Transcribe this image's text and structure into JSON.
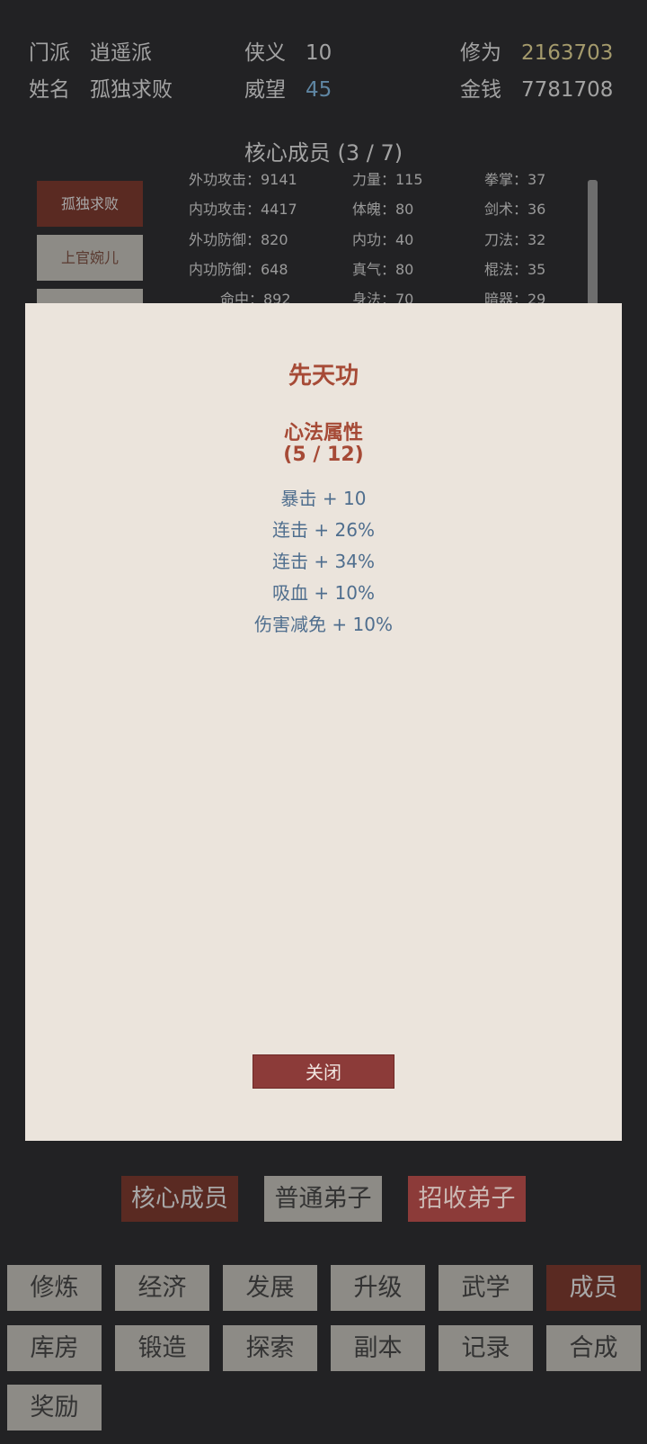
{
  "header": {
    "sect_label": "门派",
    "sect_value": "逍遥派",
    "name_label": "姓名",
    "name_value": "孤独求败",
    "chivalry_label": "侠义",
    "chivalry_value": "10",
    "prestige_label": "威望",
    "prestige_value": "45",
    "cultivation_label": "修为",
    "cultivation_value": "2163703",
    "money_label": "金钱",
    "money_value": "7781708"
  },
  "core_members": {
    "title": "核心成员 (3 / 7)",
    "members": [
      "孤独求败",
      "上官婉儿"
    ]
  },
  "stats": {
    "col1": [
      "外功攻击：9141",
      "内功攻击：4417",
      "外功防御：820",
      "内功防御：648",
      "命中：892"
    ],
    "col2": [
      "力量：115",
      "体魄：80",
      "内功：40",
      "真气：80",
      "身法：70"
    ],
    "col3": [
      "拳掌：37",
      "剑术：36",
      "刀法：32",
      "棍法：35",
      "暗器：29"
    ]
  },
  "modal": {
    "title": "先天功",
    "subtitle": "心法属性",
    "count": "(5 / 12)",
    "attributes": [
      "暴击 + 10",
      "连击 + 26%",
      "连击 + 34%",
      "吸血 + 10%",
      "伤害减免 + 10%"
    ],
    "close_label": "关闭"
  },
  "tabs": {
    "core": "核心成员",
    "normal": "普通弟子",
    "recruit": "招收弟子"
  },
  "nav": [
    "修炼",
    "经济",
    "发展",
    "升级",
    "武学",
    "成员",
    "库房",
    "锻造",
    "探索",
    "副本",
    "记录",
    "合成",
    "奖励"
  ]
}
